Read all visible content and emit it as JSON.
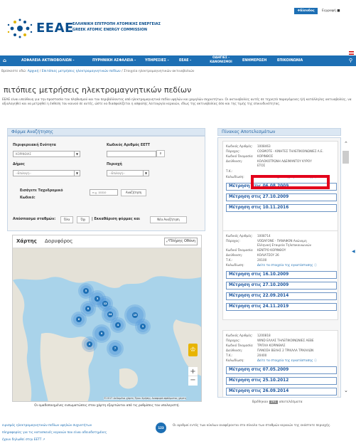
{
  "top": {
    "login": "❖Είσοδος",
    "register": "Εγγραφή"
  },
  "header": {
    "logo": "ΕΕΑΕ",
    "subtitle_gr": "ΕΛΛΗΝΙΚΗ ΕΠΙΤΡΟΠΗ ΑΤΟΜΙΚΗΣ ΕΝΕΡΓΕΙΑΣ",
    "subtitle_en": "GREEK ATOMIC ENERGY COMMISSION"
  },
  "nav": {
    "home_icon": "home-icon",
    "items": [
      "ΑΣΦΑΛΕΙΑ ΑΚΤΙΝΟΒΟΛΙΩΝ -",
      "ΠΥΡΗΝΙΚΗ ΑΣΦΑΛΕΙΑ -",
      "ΥΠΗΡΕΣΙΕΣ -",
      "ΕΕΑΕ -"
    ],
    "guides_line1": "ΟΔΗΓΙΕΣ -",
    "guides_line2": "ΚΑΝΟΝΙΣΜΟΙ",
    "news": "ΕΝΗΜΕΡΩΣΗ",
    "contact": "ΕΠΙΚΟΙΝΩΝΙΑ"
  },
  "breadcrumb": {
    "prefix": "Βρίσκεστε εδώ:",
    "home": "Αρχική",
    "sep": "/",
    "parent": "Επιτόπιες μετρήσεις ηλεκτρομαγνητικών πεδίων",
    "current": "Στοιχεία ηλεκτρομαγνητικών ακτινοβολιών"
  },
  "title": "πιτόπιες μετρήσεις ηλεκτρομαγνητικών πεδίων",
  "intro": "ΕΕΑΕ είναι υπεύθυνη για την προστασία του πληθυσμού και του περιβάλλοντος από ηλεκτρομαγνητικά πεδία υψηλών και χαμηλών συχνοτήτων. Οι ακτινοβολίες αυτές σε τεχνητά παραγόμενες ή/ή κατάλληλες ακτινοβολίες, να αξιολογηθεί και να μετρηθεί η έκθεση του κοινού σε αυτές, ώστε να διασφαλίζεται η ασφαλής λειτουργία κεραιών, ιδίως της ακτινοβολίας όσο και της τιμής της επικινδυνότητας.",
  "search_form": {
    "heading": "Φόρμα Αναζήτησης",
    "region_label": "Περιφερειακή Ενότητα",
    "region_value": "ΚΟΡΙΝΘΙΑΣ",
    "code_label": "Κωδικός Αριθμός ΕΕΤΤ",
    "municipality_label": "Δήμος",
    "municipality_value": "--Επιλογή--",
    "area_label": "Περιοχή",
    "area_value": "--Επιλογή--",
    "postal_label_1": "Εισάγετε Ταχυδρομικό",
    "postal_label_2": "Κωδικό:",
    "postal_placeholder": "π.χ. 15310",
    "postal_button": "Αναζήτηση",
    "distance_label": "Απόσπασμα σταθμών:",
    "distance_opt1": "Όλα",
    "distance_opt2": "Όχι",
    "clear_label": "Εκκαθάριση φόρμας και",
    "new_search": "Νέα Αναζήτηση"
  },
  "map": {
    "tab_map": "Χάρτης",
    "tab_satellite": "Δορυφόρος",
    "fullscreen": "Πλήρης Οθόνη",
    "attribution": "©2017 Δεδομένα χάρτη  Όροι Χρήσης  Αναφορά σφάλματος χάρτη",
    "caption": "Οι ομαδοποιημένες ενσωματώσεις στον χάρτη εξαρτώνται από τις ρυθμίσεις του υπολογιστή.",
    "clusters": [
      {
        "label": "5"
      },
      {
        "label": "3"
      },
      {
        "label": "12"
      },
      {
        "label": "8"
      },
      {
        "label": "24"
      },
      {
        "label": "6"
      },
      {
        "label": "4"
      },
      {
        "label": "9"
      },
      {
        "label": "15"
      },
      {
        "label": "3"
      },
      {
        "label": "7"
      },
      {
        "label": "2"
      }
    ]
  },
  "results": {
    "heading": "Πίνακας Αποτελεσμάτων",
    "key_code": "Κωδικός Αριθμός:",
    "key_provider": "Πάροχος:",
    "key_owner": "Κωδικό Όνομασία:",
    "key_address": "Διεύθυνση:",
    "key_tk": "Τ.Κ.:",
    "key_coords": "Καλωδίωση:",
    "coords_link": "Δείτε τα στοιχεία της εγκατάστασης",
    "measure_prefix": "Μέτρηση στις",
    "cards": [
      {
        "code": "1008463",
        "provider": "COSMOTE - ΚΙΝΗΤΕΣ ΤΗΛΕΠΙΚΟΙΝΩΝΙΕΣ Α.Ε.",
        "owner": "ΚΟΡΙΝΘΟΣ",
        "address": "ΚΟΛΟΚΟΤΡΩΝΗ ΑΔΕΙΜΑΝΤΟΥ ΚΥΡΟΥ",
        "address2": "ΕΤΟΣ",
        "tk": "",
        "dates": [
          "06.08.2009",
          "27.10.2009",
          "10.11.2016"
        ]
      },
      {
        "code": "1008714",
        "provider": "VODAFONE - ΠΑΝΑΦΟΝ Ανώνυμη",
        "provider2": "Ελληνική Εταιρεία Τηλεπικοινωνιών",
        "owner": "ΚΕΝΤΡΟ ΚΟΡΙΝΘΟΥ",
        "address": "ΚΟΛΙΑΤΣΟΥ 26",
        "tk": "20100",
        "dates": [
          "16.10.2009",
          "27.10.2009",
          "22.09.2014",
          "24.11.2019"
        ]
      },
      {
        "code": "1200818",
        "provider": "WIND ΕΛΛΑΣ ΤΗΛΕΠΙΚΟΙΝΩΝΙΕΣ ΑΕΒΕ",
        "owner": "ΤΡΙΠΛΑ ΚΟΡΙΝΘΙΑΣ",
        "address": "ΠΑΝΟΣΗ ΒΕΛΗΣ 2 ΤΡΙΚΑΛΑ ΤΡΙΚΑΛΩΝ",
        "tk": "20400",
        "dates": [
          "07.05.2009",
          "25.10.2012",
          "26.09.2014"
        ]
      }
    ],
    "footer_prefix": "Βρέθηκαν",
    "footer_count": "191",
    "footer_suffix": "αποτελέσματα"
  },
  "footer": {
    "link1": "ειρισμός ηλεκτρομαγνητικών πεδίων υψηλών συχνοτήτων",
    "link2": "πληροφορίες για τις κατασκευές κεραιών που είναι αδειοδοτημένες",
    "link3": "έχουν δηλωθεί στην ΕΕΤΤ",
    "circle": "123",
    "note": "Οι αριθμοί εντός των κύκλων αναφέρονται στο σύνολο των σταθμών κεραιών της εκάστοτε περιοχής."
  }
}
